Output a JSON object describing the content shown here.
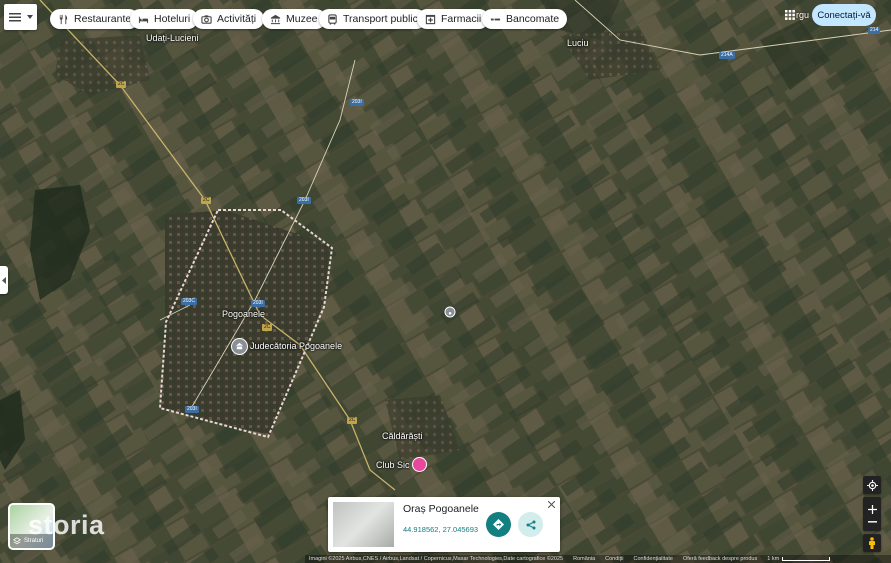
{
  "menu": {
    "icon": "hamburger-icon",
    "dropdown_icon": "caret-down-icon"
  },
  "filters": [
    {
      "label": "Restaurante",
      "icon": "fork-knife-icon"
    },
    {
      "label": "Hoteluri",
      "icon": "bed-icon"
    },
    {
      "label": "Activități",
      "icon": "camera-icon"
    },
    {
      "label": "Muzee",
      "icon": "museum-icon"
    },
    {
      "label": "Transport public",
      "icon": "bus-icon"
    },
    {
      "label": "Farmacii",
      "icon": "pharmacy-icon"
    },
    {
      "label": "Bancomate",
      "icon": "atm-icon"
    }
  ],
  "header": {
    "apps_partial_text": "rgu",
    "signin_label": "Conectați-vă"
  },
  "map": {
    "towns": [
      "Udați-Lucieni",
      "Luciu",
      "Pogoanele",
      "Căldărăști",
      "Club Sic"
    ],
    "poi": "Judecătoria Pogoanele",
    "roads": [
      "2C",
      "203I",
      "203C",
      "214A",
      "214"
    ]
  },
  "branding": {
    "watermark": "storia",
    "layers_label": "Straturi"
  },
  "place_card": {
    "title": "Oraș Pogoanele",
    "coords": "44.918562, 27.045693"
  },
  "attribution": {
    "imagery": "Imagini ©2025 Airbus,CNES / Airbus,Landsat / Copernicus,Maxar Technologies,Date cartografice ©2025",
    "country": "România",
    "terms": "Condiții",
    "privacy": "Confidențialitate",
    "feedback": "Oferă feedback despre produs",
    "scale": "1 km"
  },
  "colors": {
    "boundary": "#e8d6d0",
    "accent": "#137f80",
    "signin_bg": "#c2e7ff"
  }
}
